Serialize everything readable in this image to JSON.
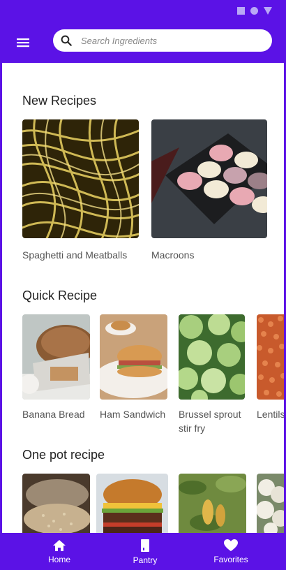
{
  "search": {
    "placeholder": "Search Ingredients"
  },
  "sections": [
    {
      "title": "New Recipes",
      "items": [
        {
          "label": "Spaghetti and Meatballs"
        },
        {
          "label": "Macroons"
        }
      ]
    },
    {
      "title": "Quick Recipe",
      "items": [
        {
          "label": "Banana Bread"
        },
        {
          "label": "Ham Sandwich"
        },
        {
          "label": "Brussel sprout stir fry"
        },
        {
          "label": "Lentils"
        }
      ]
    },
    {
      "title": "One pot recipe",
      "items": [
        {
          "label": ""
        },
        {
          "label": ""
        },
        {
          "label": ""
        },
        {
          "label": ""
        }
      ]
    }
  ],
  "nav": [
    {
      "label": "Home",
      "icon": "home-icon"
    },
    {
      "label": "Pantry",
      "icon": "pantry-icon"
    },
    {
      "label": "Favorites",
      "icon": "heart-icon"
    }
  ],
  "colors": {
    "primary": "#5b12e6",
    "status_icons": "#b9a8f6"
  }
}
